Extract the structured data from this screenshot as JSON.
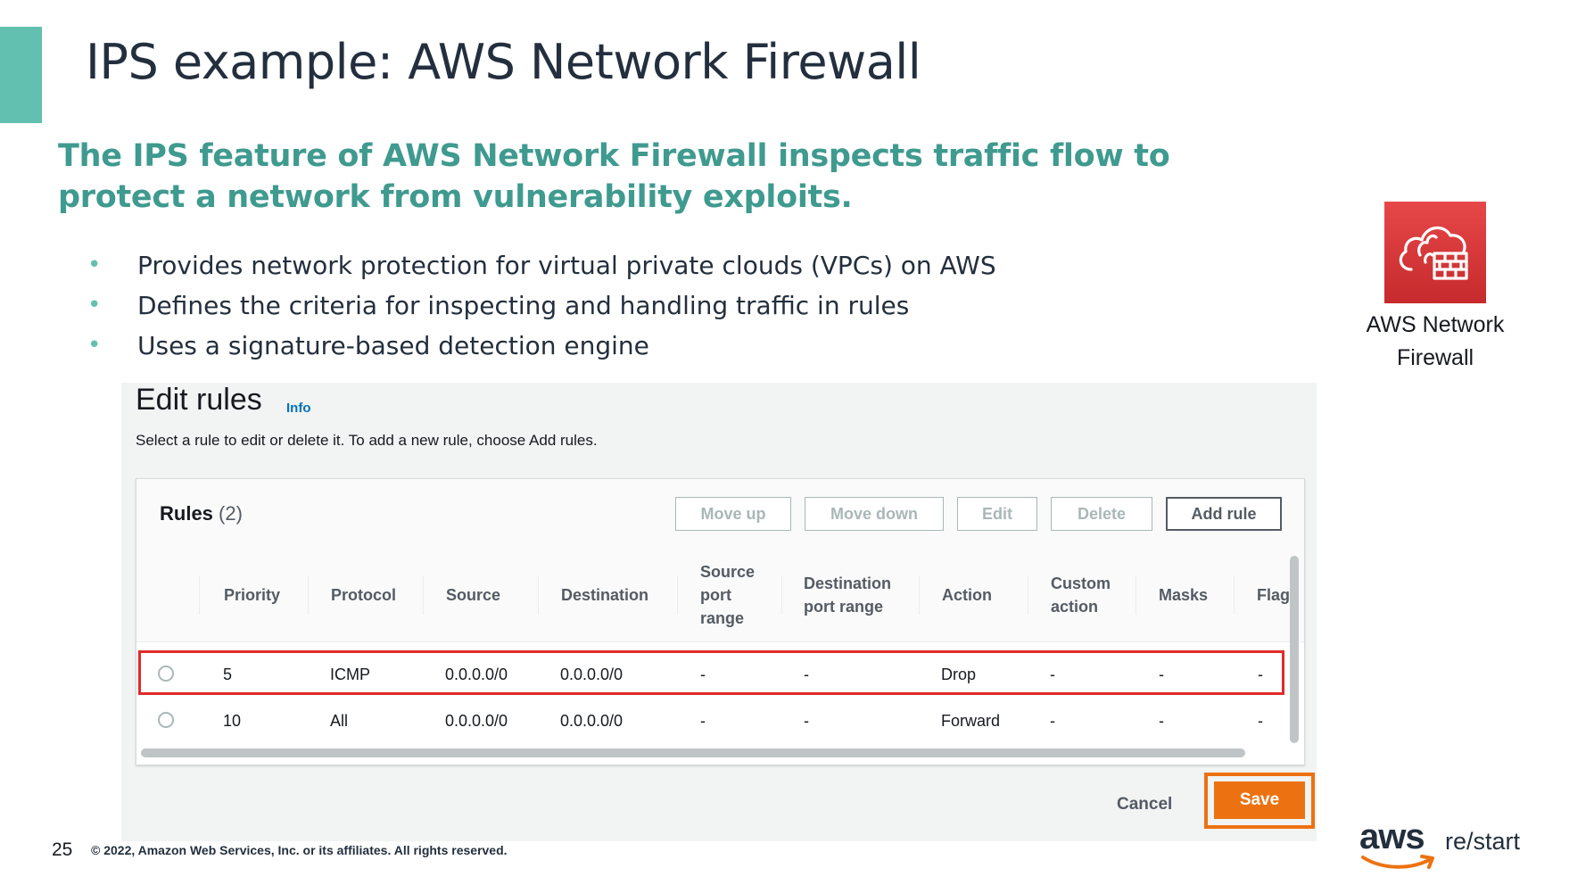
{
  "slide": {
    "title": "IPS example: AWS Network Firewall",
    "subtitle": "The IPS feature of AWS Network Firewall inspects traffic flow to protect a network from vulnerability exploits.",
    "bullets": [
      "Provides network protection for virtual private clouds (VPCs) on AWS",
      "Defines the criteria for inspecting and handling traffic in rules",
      "Uses a signature-based detection engine"
    ],
    "service_label_line1": "AWS Network",
    "service_label_line2": "Firewall",
    "page_number": "25",
    "copyright": "© 2022, Amazon Web Services, Inc. or its affiliates. All rights reserved.",
    "logo_aws": "aws",
    "logo_restart": "re/start"
  },
  "console": {
    "title": "Edit rules",
    "info": "Info",
    "description": "Select a rule to edit or delete it. To add a new rule, choose Add rules.",
    "rules_label": "Rules",
    "rules_count": "(2)",
    "buttons": {
      "move_up": "Move up",
      "move_down": "Move down",
      "edit": "Edit",
      "delete": "Delete",
      "add_rule": "Add rule",
      "cancel": "Cancel",
      "save": "Save"
    },
    "columns": {
      "priority": "Priority",
      "protocol": "Protocol",
      "source": "Source",
      "destination": "Destination",
      "source_port_range_1": "Source",
      "source_port_range_2": "port",
      "source_port_range_3": "range",
      "dest_port_range_1": "Destination",
      "dest_port_range_2": "port range",
      "action": "Action",
      "custom_action_1": "Custom",
      "custom_action_2": "action",
      "masks": "Masks",
      "flags": "Flag"
    },
    "rows": [
      {
        "priority": "5",
        "protocol": "ICMP",
        "source": "0.0.0.0/0",
        "destination": "0.0.0.0/0",
        "source_port_range": "-",
        "destination_port_range": "-",
        "action": "Drop",
        "custom_action": "-",
        "masks": "-",
        "flags": "-"
      },
      {
        "priority": "10",
        "protocol": "All",
        "source": "0.0.0.0/0",
        "destination": "0.0.0.0/0",
        "source_port_range": "-",
        "destination_port_range": "-",
        "action": "Forward",
        "custom_action": "-",
        "masks": "-",
        "flags": "-"
      }
    ]
  },
  "colors": {
    "accent_teal": "#62c0b0",
    "highlight_red": "#e02b2b",
    "save_orange": "#ec7211",
    "service_icon_red": "#d13212"
  }
}
